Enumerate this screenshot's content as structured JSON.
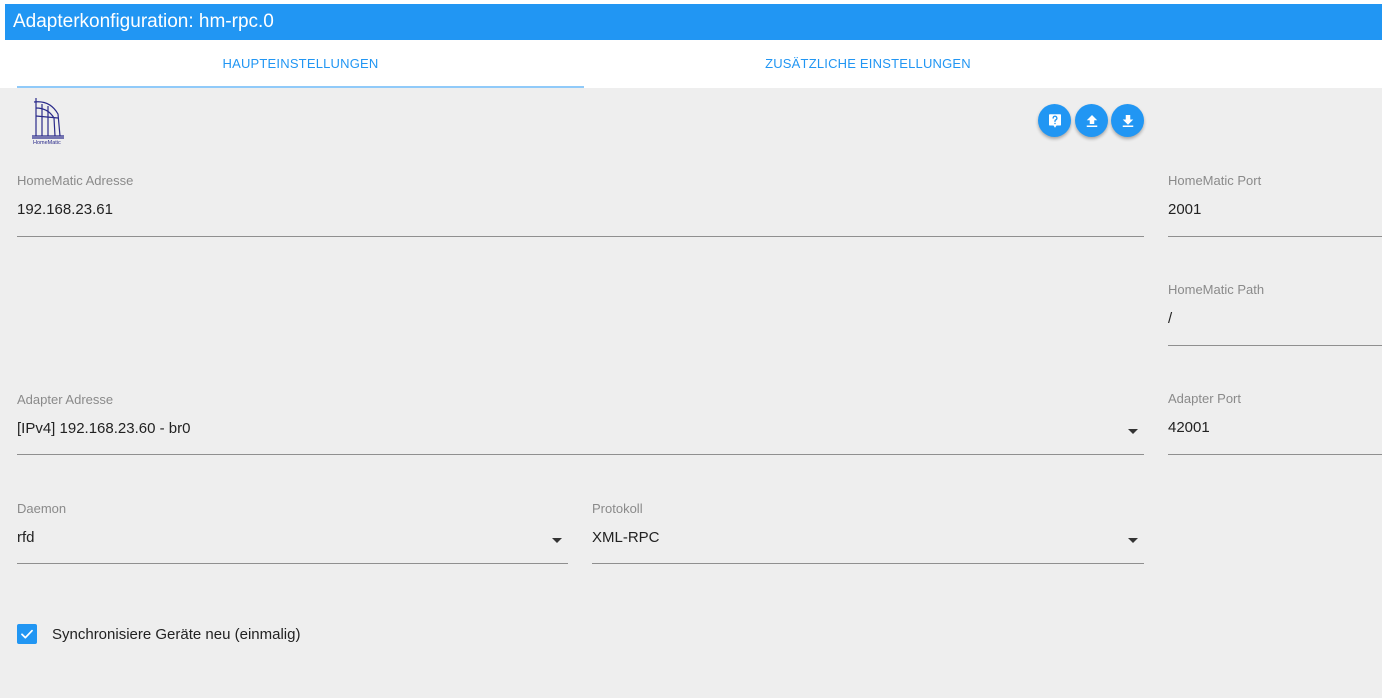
{
  "window": {
    "title": "Adapterkonfiguration: hm-rpc.0"
  },
  "tabs": [
    {
      "label": "HAUPTEINSTELLUNGEN",
      "active": true
    },
    {
      "label": "ZUSÄTZLICHE EINSTELLUNGEN",
      "active": false
    }
  ],
  "colors": {
    "accent": "#2196f3",
    "tab_indicator": "#90caf9",
    "background": "#eeeeee"
  },
  "logo": {
    "text": "HomeMatic"
  },
  "actions": [
    {
      "name": "help",
      "icon": "help-icon"
    },
    {
      "name": "upload",
      "icon": "upload-icon"
    },
    {
      "name": "download",
      "icon": "download-icon"
    }
  ],
  "fields": {
    "homematic_address": {
      "label": "HomeMatic Adresse",
      "value": "192.168.23.61"
    },
    "homematic_port": {
      "label": "HomeMatic Port",
      "value": "2001"
    },
    "homematic_path": {
      "label": "HomeMatic Path",
      "value": "/"
    },
    "adapter_address": {
      "label": "Adapter Adresse",
      "value": "[IPv4] 192.168.23.60 - br0"
    },
    "adapter_port": {
      "label": "Adapter Port",
      "value": "42001"
    },
    "daemon": {
      "label": "Daemon",
      "value": "rfd"
    },
    "protocol": {
      "label": "Protokoll",
      "value": "XML-RPC"
    }
  },
  "sync_checkbox": {
    "label": "Synchronisiere Geräte neu (einmalig)",
    "checked": true
  }
}
